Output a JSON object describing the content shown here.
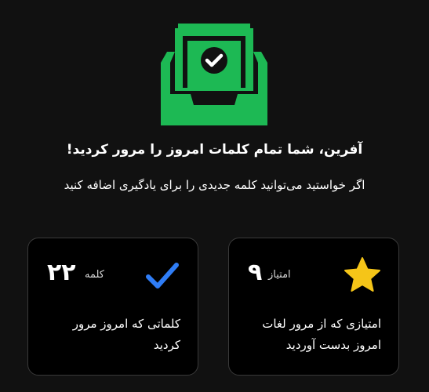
{
  "colors": {
    "background": "#111111",
    "card_background": "#000000",
    "card_border": "#3a3a3a",
    "inbox_green": "#1db954",
    "check_blue": "#2f7df6",
    "star_yellow": "#f5c518"
  },
  "hero": {
    "icon": "inbox-check-icon",
    "headline": "آفرین، شما تمام کلمات امروز را مرور کردید!",
    "subline": "اگر خواستید می‌توانید کلمه جدیدی را برای یادگیری اضافه کنید"
  },
  "stats": {
    "words": {
      "icon": "checkmark-icon",
      "value": "۲۲",
      "unit": "کلمه",
      "description": "کلماتی که امروز مرور کردید"
    },
    "points": {
      "icon": "star-icon",
      "value": "۹",
      "unit": "امتیاز",
      "description": "امتیازی که از مرور لغات امروز بدست آوردید"
    }
  }
}
